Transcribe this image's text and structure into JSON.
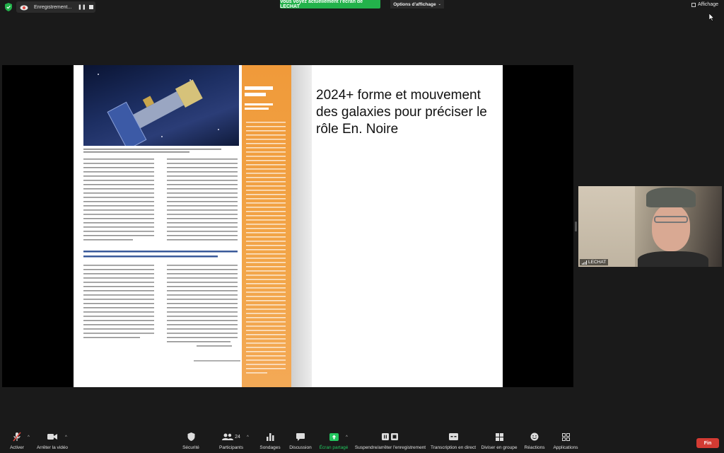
{
  "top_bar": {
    "recording_label": "Enregistrement...",
    "share_banner": "Vous voyez actuellement l'écran de LECHAT",
    "view_options": "Options d'affichage",
    "view_button": "Affichage"
  },
  "slide": {
    "text": "2024+ forme et mouvement des galaxies pour préciser le rôle En. Noire"
  },
  "video": {
    "participant_name": "LECHAT"
  },
  "toolbar": {
    "mute": "Activer",
    "stop_video": "Arrêter la vidéo",
    "security": "Sécurité",
    "participants": "Participants",
    "participants_count": "24",
    "polls": "Sondages",
    "chat": "Discussion",
    "share_screen": "Écran partagé",
    "pause_recording": "Suspendre/arrêter l'enregistrement",
    "live_transcript": "Transcription en direct",
    "breakout_rooms": "Diviser en groupe",
    "reactions": "Réactions",
    "apps": "Applications",
    "end": "Fin"
  },
  "colors": {
    "share_banner": "#23b24b",
    "end_button": "#d43b33",
    "share_label": "#22c55e",
    "magazine_accent": "#f09a3a"
  }
}
